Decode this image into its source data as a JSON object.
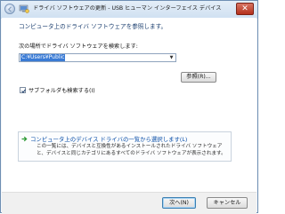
{
  "window": {
    "title": "ドライバ ソフトウェアの更新 - USB ヒューマン インターフェイス デバイス",
    "close_label": "✕"
  },
  "main": {
    "heading": "コンピュータ上のドライバ ソフトウェアを参照します。",
    "search_label": "次の場所でドライバ ソフトウェアを検索します:",
    "path_value": "C:¥Users¥Public",
    "browse_label": "参照(R)...",
    "include_subfolders_label": "サブフォルダも検索する(I)",
    "include_subfolders_checked": true,
    "option_title": "コンピュータ上のデバイス ドライバの一覧から選択します(L)",
    "option_desc": "この一覧には、デバイスと互換性があるインストールされたドライバ ソフトウェアと、デバイスと同じカテゴリにあるすべてのドライバ ソフトウェアが表示されます。"
  },
  "footer": {
    "next_label": "次へ(N)",
    "cancel_label": "キャンセル"
  },
  "icons": {
    "back": "back-arrow-icon",
    "wizard": "hardware-wizard-icon",
    "option_arrow": "green-arrow-icon",
    "dropdown": "chevron-down-icon"
  }
}
